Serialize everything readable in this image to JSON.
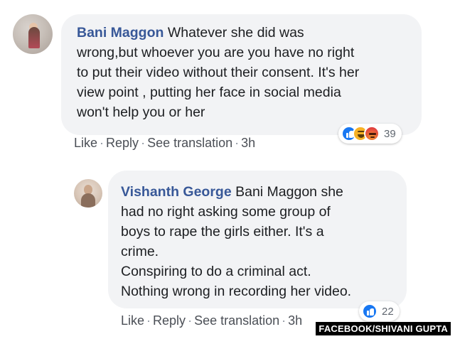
{
  "comments": [
    {
      "author": "Bani Maggon",
      "text_lines": [
        "Whatever she did was",
        "wrong,but whoever you are you have no right",
        "to put their video without their consent. It's her",
        "view point , putting her face in social media",
        "won't help you or her"
      ],
      "actions": {
        "like": "Like",
        "reply": "Reply",
        "translate": "See translation",
        "time": "3h",
        "separator": "·"
      },
      "reactions": {
        "icons": [
          "like-icon",
          "haha-icon",
          "angry-icon"
        ],
        "count": "39"
      }
    },
    {
      "author": "Vishanth George",
      "text_lines": [
        "Bani Maggon she",
        "had no right asking some group of",
        "boys to rape the girls either. It's a",
        "crime.",
        "Conspiring to do a criminal act.",
        "Nothing wrong in recording her video."
      ],
      "actions": {
        "like": "Like",
        "reply": "Reply",
        "translate": "See translation",
        "time": "3h",
        "separator": "·"
      },
      "reactions": {
        "icons": [
          "like-icon"
        ],
        "count": "22"
      }
    }
  ],
  "credit": "FACEBOOK/SHIVANI GUPTA",
  "colors": {
    "author": "#385898",
    "bubble": "#f2f3f5",
    "action_text": "#606770",
    "like_blue": "#1877f2"
  }
}
